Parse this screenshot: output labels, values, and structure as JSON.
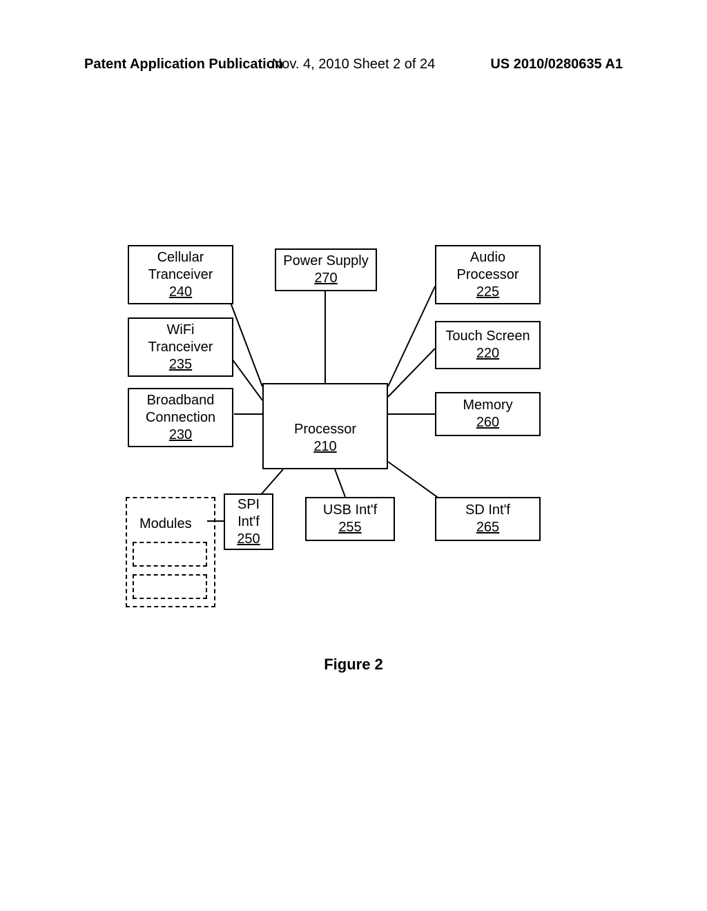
{
  "header": {
    "left": "Patent Application Publication",
    "center": "Nov. 4, 2010  Sheet 2 of 24",
    "right": "US 2010/0280635 A1"
  },
  "figure": {
    "caption": "Figure 2",
    "processor": {
      "label": "Processor",
      "ref": "210"
    },
    "touch_screen": {
      "label": "Touch Screen",
      "ref": "220"
    },
    "audio_processor": {
      "label1": "Audio",
      "label2": "Processor",
      "ref": "225"
    },
    "broadband": {
      "label1": "Broadband",
      "label2": "Connection",
      "ref": "230"
    },
    "wifi": {
      "label1": "WiFi",
      "label2": "Tranceiver",
      "ref": "235"
    },
    "cellular": {
      "label1": "Cellular",
      "label2": "Tranceiver",
      "ref": "240"
    },
    "spi": {
      "label1": "SPI",
      "label2": "Int'f",
      "ref": "250"
    },
    "usb": {
      "label": "USB Int'f",
      "ref": "255"
    },
    "memory": {
      "label": "Memory",
      "ref": "260"
    },
    "sd": {
      "label": "SD Int'f",
      "ref": "265"
    },
    "power": {
      "label": "Power Supply",
      "ref": "270"
    },
    "modules": {
      "label": "Modules"
    }
  }
}
